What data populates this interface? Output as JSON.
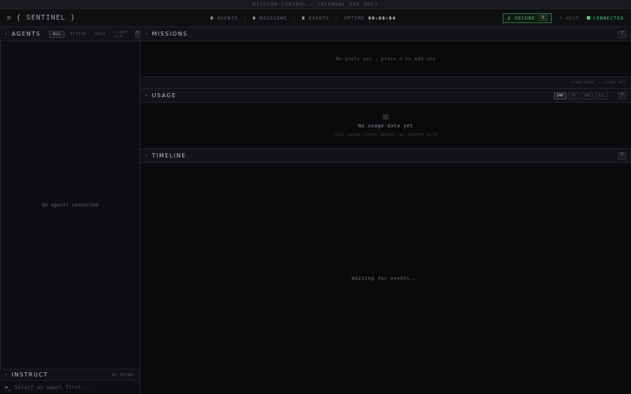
{
  "banner": "MISSION CONTROL — INTERNAL USE ONLY",
  "brand": {
    "icon": "gear-icon",
    "name": "{ SENTINEL }"
  },
  "stats": {
    "agents_count": "0",
    "agents_label": "AGENTS",
    "missions_count": "0",
    "missions_label": "MISSIONS",
    "events_count": "0",
    "events_label": "EVENTS",
    "uptime_label": "UPTIME",
    "uptime_value": "00:00:04"
  },
  "secure": {
    "label": "SECURE",
    "count": "0",
    "color": "#4ed37c"
  },
  "help": "? HELP",
  "connection": {
    "label": "CONNECTED",
    "color": "#3ed06e"
  },
  "agents": {
    "title": "AGENTS",
    "filters": [
      "ALL",
      "ACTIVE",
      "IDLE",
      "clear old"
    ],
    "active_filter": "ALL",
    "btn": "⎘",
    "empty": "No agents connected"
  },
  "instruct": {
    "title": "INSTRUCT",
    "target": "no target",
    "prompt": ">_",
    "placeholder": "Select an agent first..."
  },
  "missions": {
    "title": "MISSIONS",
    "btn": "⎘",
    "empty": "No goals yet — press n to add one",
    "clear_done": "clear done",
    "clear_all": "clear all"
  },
  "usage": {
    "title": "USAGE",
    "ranges": [
      "24H",
      "7D",
      "30D",
      "ALL"
    ],
    "active_range": "24H",
    "btn": "⎘",
    "empty": "No usage data yet",
    "sub": "Tool usage stats appear as agents work"
  },
  "timeline": {
    "title": "TIMELINE",
    "btn": "⎘",
    "empty": "Waiting for events..."
  }
}
